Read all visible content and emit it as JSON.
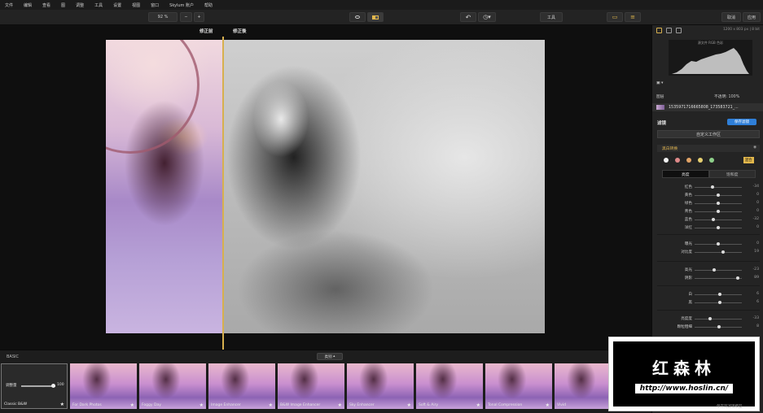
{
  "menu": [
    "文件",
    "编辑",
    "查看",
    "图",
    "调整",
    "工具",
    "设置",
    "视图",
    "窗口",
    "Skylum 账户",
    "帮助"
  ],
  "toolbar": {
    "zoom": "92 %",
    "zoom_out": "−",
    "zoom_in": "+",
    "tools": "工具",
    "cancel": "取消",
    "apply": "应用"
  },
  "viewer": {
    "before": "修正前",
    "after": "修正後"
  },
  "strip": {
    "section": "BASIC",
    "category": "类别",
    "sync": "同步预设",
    "first": {
      "label": "调整量",
      "value": "100",
      "name": "Classic B&W"
    },
    "presets": [
      "For Dark Photos",
      "Foggy Day",
      "Image Enhancer",
      "B&W Image Enhancer",
      "Sky Enhancer",
      "Soft & Airy",
      "Tonal Compression",
      "Vivid"
    ]
  },
  "right": {
    "dims": "1200 x 803 px | 8 bit",
    "hist_title": "源文件 RGB 色彩",
    "layers": "图层",
    "opacity": "不透明: 100%",
    "file": "1535971716665808_173583721_...",
    "filter": "滤镜",
    "save": "保存滤镜",
    "workspace": "自定义工作区",
    "section": "黑白转换",
    "mix": "混合",
    "seg_on": "亮度",
    "seg_off": "饱和度",
    "sliders": [
      {
        "label": "红色",
        "value": "-34",
        "pos": 0.38
      },
      {
        "label": "黄色",
        "value": "0",
        "pos": 0.5
      },
      {
        "label": "绿色",
        "value": "0",
        "pos": 0.5
      },
      {
        "label": "青色",
        "value": "0",
        "pos": 0.5
      },
      {
        "label": "蓝色",
        "value": "-32",
        "pos": 0.4
      },
      {
        "label": "洋红",
        "value": "0",
        "pos": 0.5
      },
      {
        "label": "曝光",
        "value": "0",
        "pos": 0.5
      },
      {
        "label": "对比度",
        "value": "19",
        "pos": 0.6
      },
      {
        "label": "高光",
        "value": "-23",
        "pos": 0.42
      },
      {
        "label": "阴影",
        "value": "89",
        "pos": 0.92
      },
      {
        "label": "白",
        "value": "6",
        "pos": 0.53
      },
      {
        "label": "黑",
        "value": "6",
        "pos": 0.53
      },
      {
        "label": "亮度度",
        "value": "-33",
        "pos": 0.32
      },
      {
        "label": "颗粒粗细",
        "value": "8",
        "pos": 0.52
      }
    ],
    "amount_label": "应用滤镜数量",
    "amount_value": "100",
    "bottom": "保存到滤镜模型"
  },
  "watermark": {
    "title": "红森林",
    "url": "http://www.hoslin.cn/"
  },
  "colors": {
    "accent": "#d7b04e",
    "blue": "#2f7fd8"
  }
}
